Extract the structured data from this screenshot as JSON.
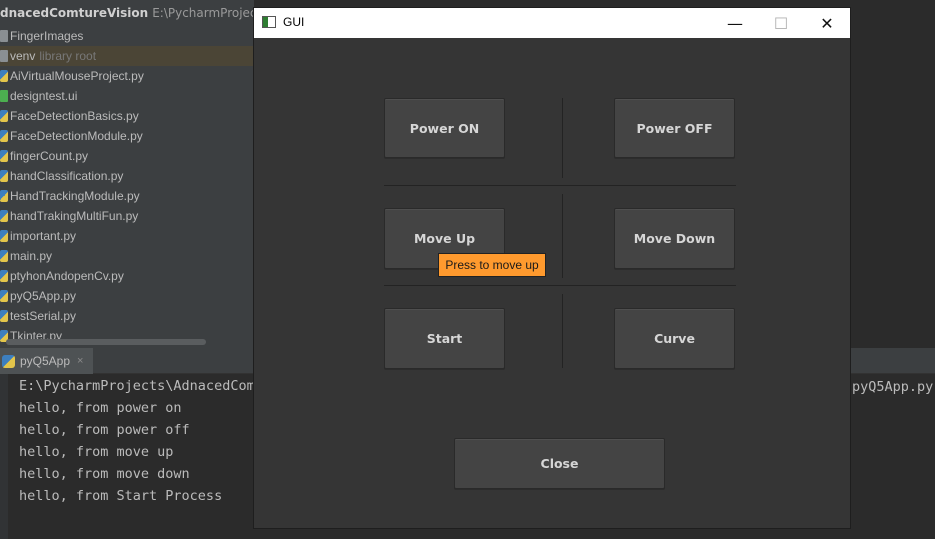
{
  "ide": {
    "project_name": "dnacedComtureVision",
    "project_path": "E:\\PycharmProjects\\Adn",
    "tree": [
      {
        "label": "FingerImages",
        "type": "folder"
      },
      {
        "label": "venv",
        "hint": "library root",
        "type": "folder",
        "selected": true
      },
      {
        "label": "AiVirtualMouseProject.py",
        "type": "py"
      },
      {
        "label": "designtest.ui",
        "type": "ui"
      },
      {
        "label": "FaceDetectionBasics.py",
        "type": "py"
      },
      {
        "label": "FaceDetectionModule.py",
        "type": "py"
      },
      {
        "label": "fingerCount.py",
        "type": "py"
      },
      {
        "label": "handClassification.py",
        "type": "py"
      },
      {
        "label": "HandTrackingModule.py",
        "type": "py"
      },
      {
        "label": "handTrakingMultiFun.py",
        "type": "py"
      },
      {
        "label": "important.py",
        "type": "py"
      },
      {
        "label": "main.py",
        "type": "py"
      },
      {
        "label": "ptyhonAndopenCv.py",
        "type": "py"
      },
      {
        "label": "pyQ5App.py",
        "type": "py"
      },
      {
        "label": "testSerial.py",
        "type": "py"
      },
      {
        "label": "Tkinter.py",
        "type": "py"
      }
    ],
    "run_tab": {
      "label": "pyQ5App",
      "close": "×"
    },
    "console": {
      "lines": [
        "E:\\PycharmProjects\\AdnacedComt",
        "hello, from power on",
        "hello, from power off",
        "hello, from move up",
        "hello, from move down",
        "hello, from Start Process"
      ],
      "first_line_tail": "pyQ5App.py"
    }
  },
  "gui": {
    "title": "GUI",
    "controls": {
      "minimize": "—",
      "maximize": "☐",
      "close": "✕"
    },
    "buttons": {
      "power_on": "Power ON",
      "power_off": "Power OFF",
      "move_up": "Move Up",
      "move_down": "Move Down",
      "start": "Start",
      "curve": "Curve",
      "close": "Close"
    },
    "tooltip": "Press to move up"
  },
  "colors": {
    "ide_panel": "#3c3f41",
    "ide_editor": "#2b2b2b",
    "gui_background": "#353535",
    "button": "#444444",
    "tooltip": "#ff9a2e"
  }
}
